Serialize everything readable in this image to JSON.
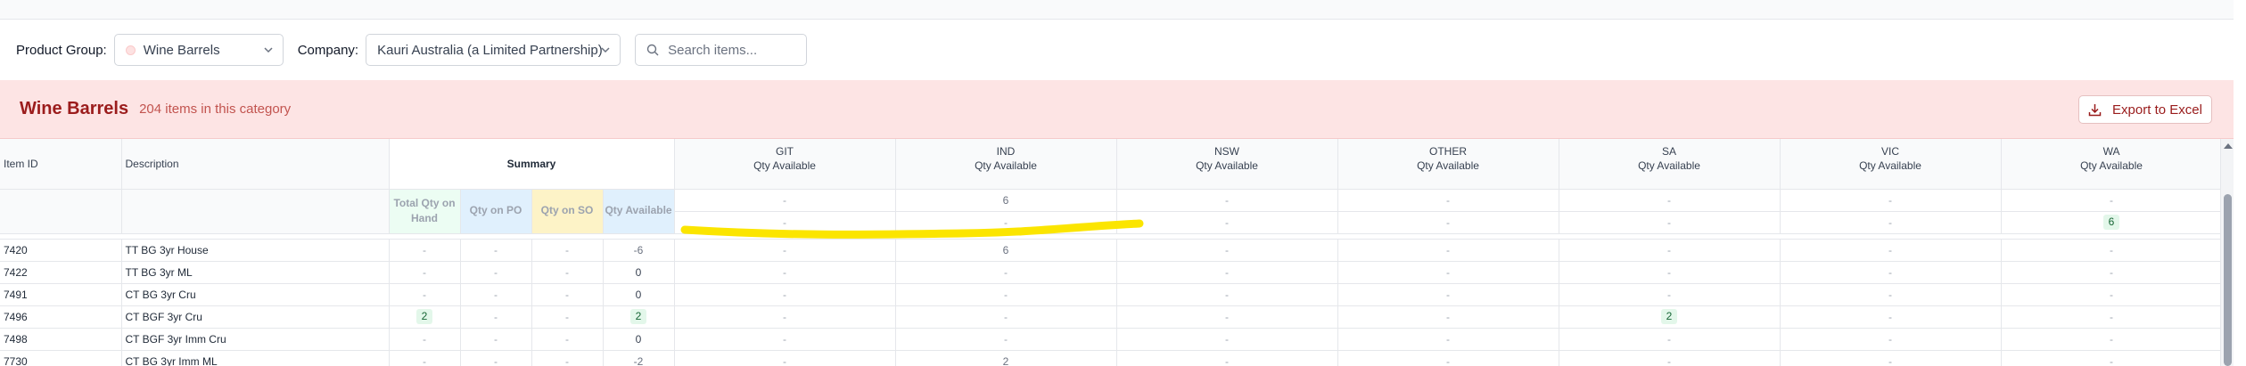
{
  "filters": {
    "product_group_label": "Product Group:",
    "product_group_value": "Wine Barrels",
    "company_label": "Company:",
    "company_value": "Kauri Australia (a Limited Partnership)",
    "search_placeholder": "Search items..."
  },
  "banner": {
    "title": "Wine Barrels",
    "count_text": "204 items in this category",
    "export_label": "Export to Excel"
  },
  "table": {
    "col_item_id": "Item ID",
    "col_description": "Description",
    "summary_label": "Summary",
    "summary_cols": [
      "Total Qty on Hand",
      "Qty on PO",
      "Qty on SO",
      "Qty Available"
    ],
    "regions": [
      "GIT",
      "IND",
      "NSW",
      "OTHER",
      "SA",
      "VIC",
      "WA"
    ],
    "region_sub": "Qty Available",
    "totals_rows": [
      [
        "-",
        "6",
        "-",
        "-",
        "-",
        "-",
        "-"
      ],
      [
        "-",
        "-",
        "-",
        "-",
        "-",
        "-",
        "6"
      ]
    ],
    "rows": [
      {
        "id": "7420",
        "desc": "TT BG 3yr House",
        "tq": "-",
        "po": "-",
        "so": "-",
        "qa": "-6",
        "regions": [
          "-",
          "6",
          "-",
          "-",
          "-",
          "-",
          "-"
        ]
      },
      {
        "id": "7422",
        "desc": "TT BG 3yr ML",
        "tq": "-",
        "po": "-",
        "so": "-",
        "qa": "0",
        "regions": [
          "-",
          "-",
          "-",
          "-",
          "-",
          "-",
          "-"
        ]
      },
      {
        "id": "7491",
        "desc": "CT BG 3yr Cru",
        "tq": "-",
        "po": "-",
        "so": "-",
        "qa": "0",
        "regions": [
          "-",
          "-",
          "-",
          "-",
          "-",
          "-",
          "-"
        ]
      },
      {
        "id": "7496",
        "desc": "CT BGF 3yr Cru",
        "tq": "2",
        "po": "-",
        "so": "-",
        "qa": "2",
        "regions": [
          "-",
          "-",
          "-",
          "-",
          "2",
          "-",
          "-"
        ]
      },
      {
        "id": "7498",
        "desc": "CT BGF 3yr Imm Cru",
        "tq": "-",
        "po": "-",
        "so": "-",
        "qa": "0",
        "regions": [
          "-",
          "-",
          "-",
          "-",
          "-",
          "-",
          "-"
        ]
      },
      {
        "id": "7730",
        "desc": "CT BG 3yr Imm ML",
        "tq": "-",
        "po": "-",
        "so": "-",
        "qa": "-2",
        "regions": [
          "-",
          "2",
          "-",
          "-",
          "-",
          "-",
          "-"
        ]
      }
    ]
  },
  "colors": {
    "banner_bg": "#fde4e4",
    "banner_title": "#9b1c1c",
    "highlight": "#fbe500",
    "pill_bg": "#e3f7ea",
    "pill_text": "#166534"
  }
}
